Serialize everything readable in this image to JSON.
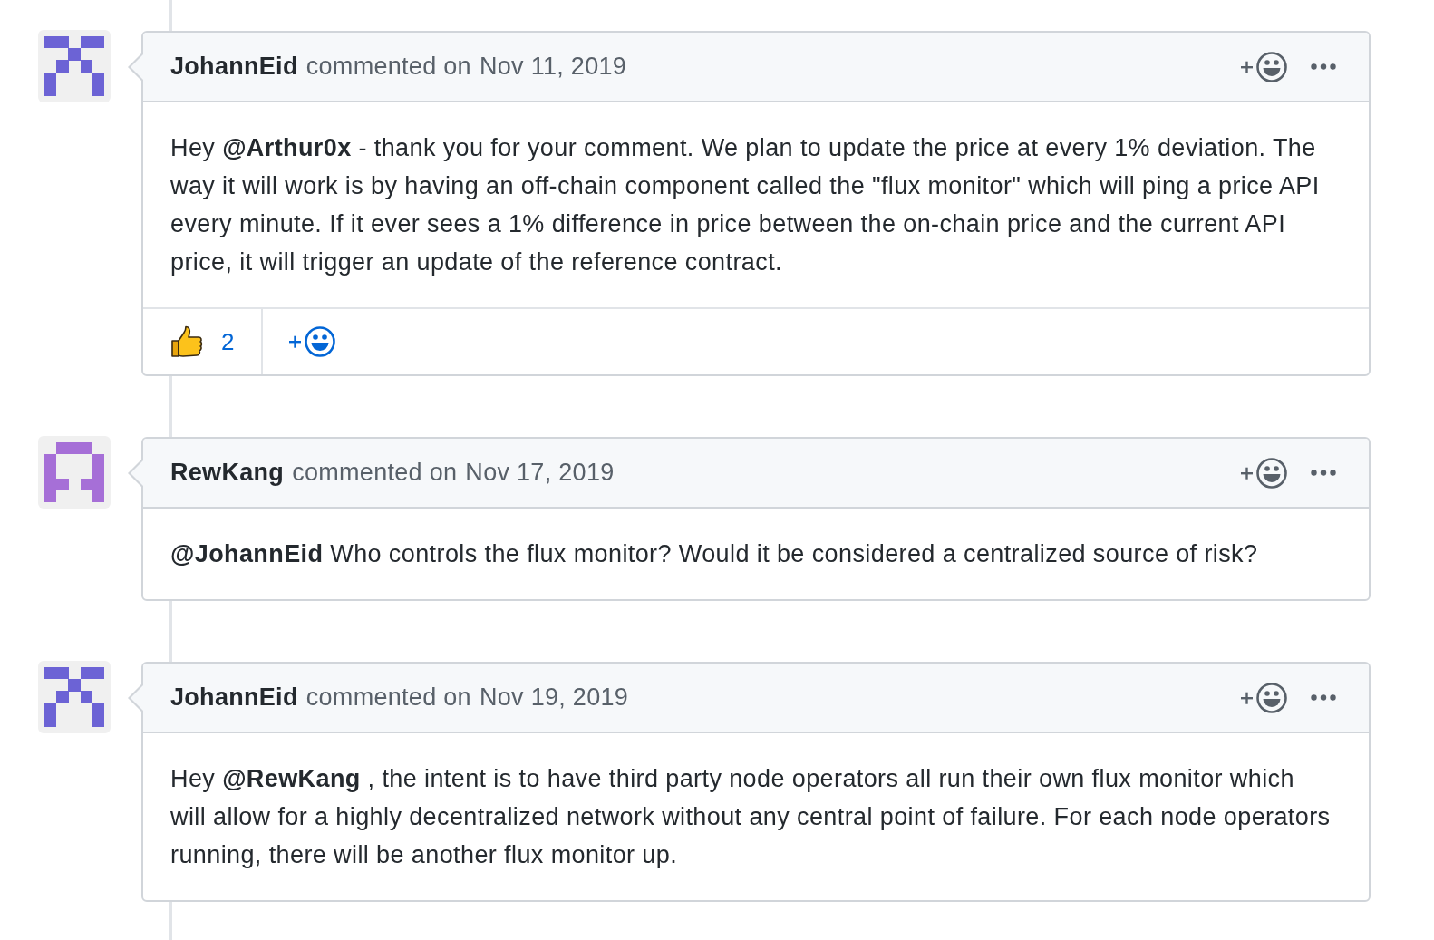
{
  "timeline": {
    "comments": [
      {
        "avatar": {
          "kind": "cross",
          "color": "#6c63d5"
        },
        "author": "JohannEid",
        "action": "commented on",
        "date": "Nov 11, 2019",
        "body": "Hey **@Arthur0x** - thank you for your comment. We plan to update the price at every 1% deviation. The way it will work is by having an off-chain component called the \"flux monitor\" which will ping a price API every minute. If it ever sees a 1% difference in price between the on-chain price and the current API price, it will trigger an update of the reference contract.",
        "reactions": [
          {
            "kind": "thumbs_up",
            "count": "2"
          }
        ]
      },
      {
        "avatar": {
          "kind": "arch",
          "color": "#a66fd7"
        },
        "author": "RewKang",
        "action": "commented on",
        "date": "Nov 17, 2019",
        "body": "**@JohannEid** Who controls the flux monitor? Would it be considered a centralized source of risk?"
      },
      {
        "avatar": {
          "kind": "cross",
          "color": "#6c63d5"
        },
        "author": "JohannEid",
        "action": "commented on",
        "date": "Nov 19, 2019",
        "body": "Hey **@RewKang** , the intent is to have third party node operators all run their own flux monitor which will allow for a highly decentralized network without any central point of failure. For each node operators running, there will be another flux monitor up."
      }
    ]
  }
}
